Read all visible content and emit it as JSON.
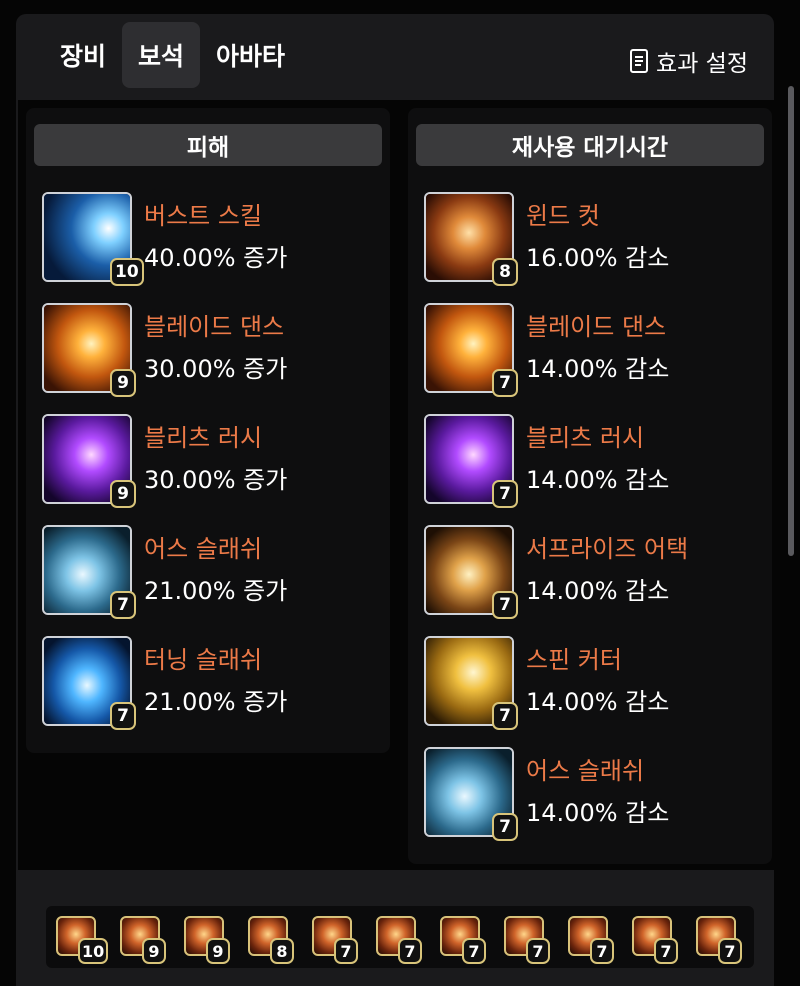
{
  "tabs": [
    {
      "label": "장비"
    },
    {
      "label": "보석"
    },
    {
      "label": "아바타"
    }
  ],
  "settings_label": "효과 설정",
  "damage": {
    "title": "피해",
    "items": [
      {
        "name": "버스트 스킬",
        "value": "40.00% 증가",
        "level": "10",
        "icon": "blue-burst-gem"
      },
      {
        "name": "블레이드 댄스",
        "value": "30.00% 증가",
        "level": "9",
        "icon": "orange-blade-gem"
      },
      {
        "name": "블리츠 러시",
        "value": "30.00% 증가",
        "level": "9",
        "icon": "purple-blitz-gem"
      },
      {
        "name": "어스 슬래쉬",
        "value": "21.00% 증가",
        "level": "7",
        "icon": "blue-swirl-gem"
      },
      {
        "name": "터닝 슬래쉬",
        "value": "21.00% 증가",
        "level": "7",
        "icon": "blue-spin-gem"
      }
    ]
  },
  "cooldown": {
    "title": "재사용 대기시간",
    "items": [
      {
        "name": "윈드 컷",
        "value": "16.00% 감소",
        "level": "8",
        "icon": "orange-web-gem"
      },
      {
        "name": "블레이드 댄스",
        "value": "14.00% 감소",
        "level": "7",
        "icon": "orange-blade-gem"
      },
      {
        "name": "블리츠 러시",
        "value": "14.00% 감소",
        "level": "7",
        "icon": "purple-blitz-gem"
      },
      {
        "name": "서프라이즈 어택",
        "value": "14.00% 감소",
        "level": "7",
        "icon": "gold-orb-gem"
      },
      {
        "name": "스핀 커터",
        "value": "14.00% 감소",
        "level": "7",
        "icon": "gold-figure-gem"
      },
      {
        "name": "어스 슬래쉬",
        "value": "14.00% 감소",
        "level": "7",
        "icon": "blue-swirl-gem"
      }
    ]
  },
  "gem_strip": [
    "10",
    "9",
    "9",
    "8",
    "7",
    "7",
    "7",
    "7",
    "7",
    "7",
    "7"
  ],
  "colors": {
    "skill_name": "#ec7a48",
    "level_border": "#d8c47a",
    "header_bg": "#3a3a3c"
  }
}
